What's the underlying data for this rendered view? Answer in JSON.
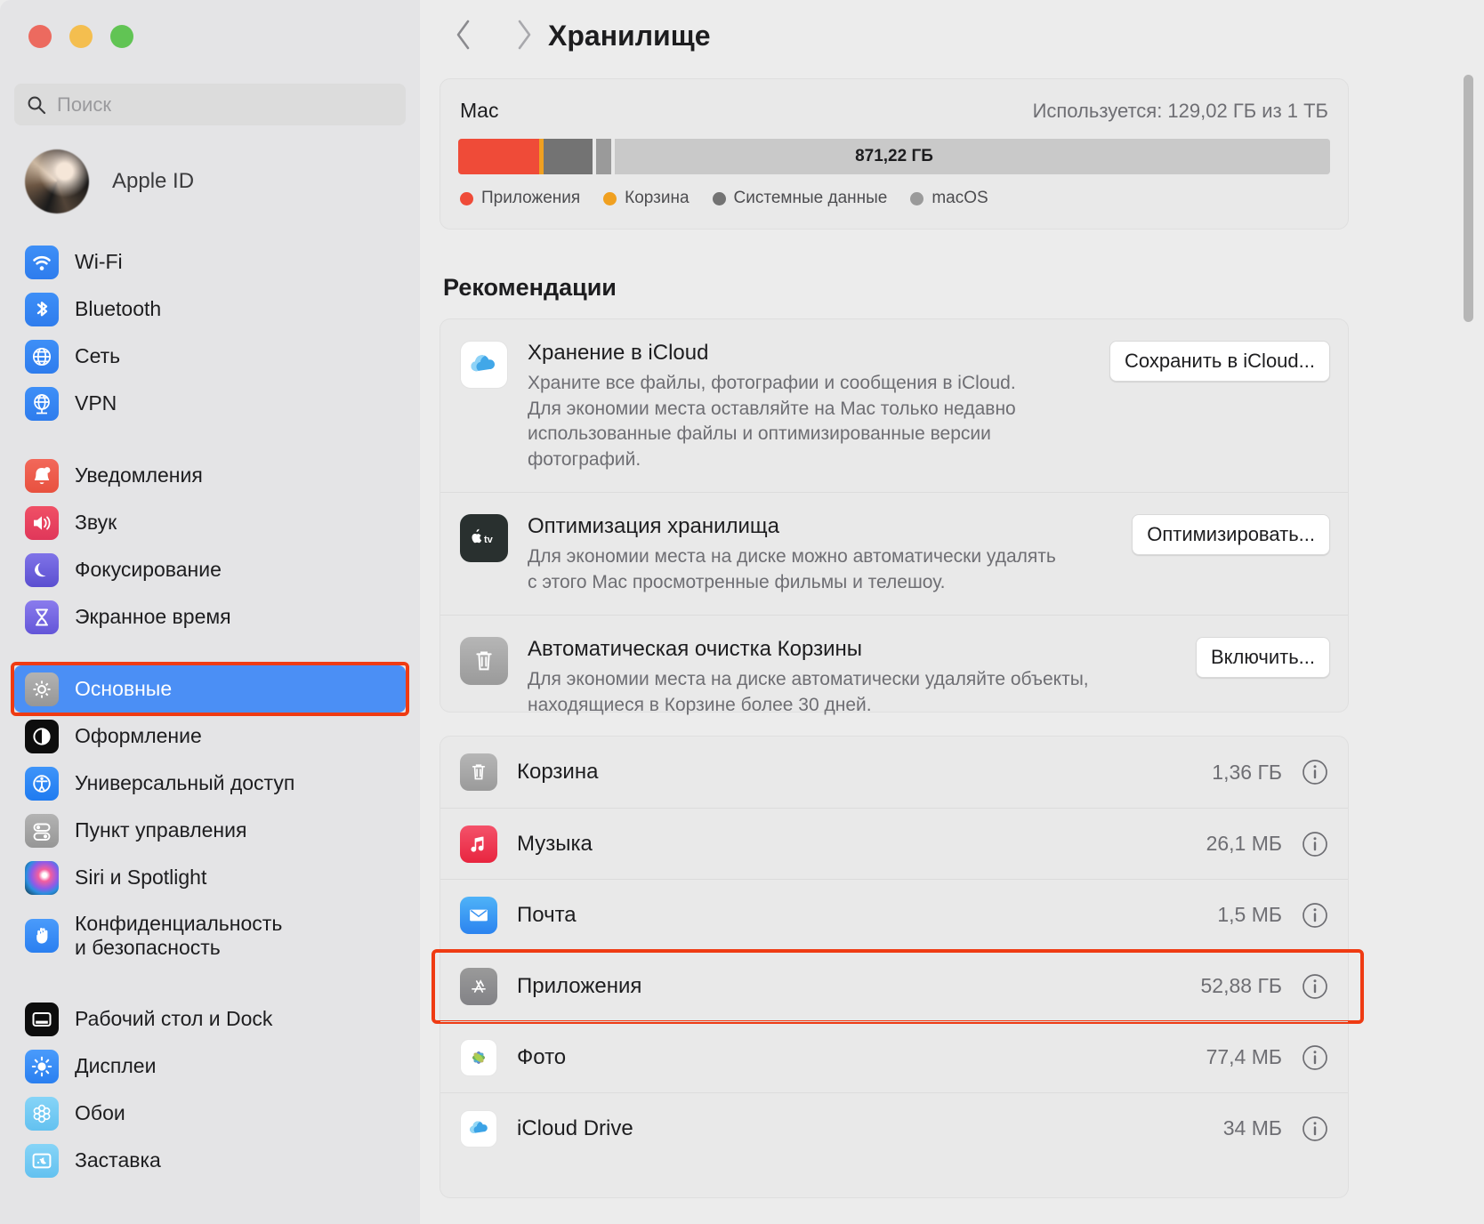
{
  "window": {
    "traffic_lights": [
      "close",
      "minimize",
      "zoom"
    ],
    "colors": {
      "close": "#ec6a5f",
      "minimize": "#f4be4f",
      "zoom": "#61c454",
      "accent": "#4b8ff5",
      "highlight": "#ef3b13"
    }
  },
  "sidebar": {
    "search": {
      "placeholder": "Поиск",
      "icon": "search-icon",
      "value": ""
    },
    "account": {
      "label": "Apple ID",
      "avatar": "user-avatar"
    },
    "groups": [
      {
        "items": [
          {
            "label": "Wi-Fi",
            "icon": "wifi-icon"
          },
          {
            "label": "Bluetooth",
            "icon": "bluetooth-icon"
          },
          {
            "label": "Сеть",
            "icon": "network-globe-icon"
          },
          {
            "label": "VPN",
            "icon": "vpn-globe-icon"
          }
        ]
      },
      {
        "items": [
          {
            "label": "Уведомления",
            "icon": "bell-icon"
          },
          {
            "label": "Звук",
            "icon": "speaker-icon"
          },
          {
            "label": "Фокусирование",
            "icon": "moon-icon"
          },
          {
            "label": "Экранное время",
            "icon": "hourglass-icon"
          }
        ]
      },
      {
        "items": [
          {
            "label": "Основные",
            "icon": "gear-icon",
            "selected": true,
            "highlighted": true
          },
          {
            "label": "Оформление",
            "icon": "appearance-icon"
          },
          {
            "label": "Универсальный доступ",
            "icon": "accessibility-icon"
          },
          {
            "label": "Пункт управления",
            "icon": "control-center-icon"
          },
          {
            "label": "Siri и Spotlight",
            "icon": "siri-icon"
          },
          {
            "label": "Конфиденциальность\nи безопасность",
            "icon": "hand-privacy-icon",
            "two_line": true
          }
        ]
      },
      {
        "items": [
          {
            "label": "Рабочий стол и Dock",
            "icon": "desktop-dock-icon"
          },
          {
            "label": "Дисплеи",
            "icon": "brightness-icon"
          },
          {
            "label": "Обои",
            "icon": "wallpaper-icon"
          },
          {
            "label": "Заставка",
            "icon": "screensaver-icon"
          }
        ]
      }
    ]
  },
  "main": {
    "back_label": "Назад",
    "forward_label": "Вперед",
    "title": "Хранилище",
    "storage": {
      "device_name": "Mac",
      "used_text": "Используется: 129,02 ГБ из 1 ТБ",
      "free_label": "871,22 ГБ",
      "legend": [
        {
          "label": "Приложения",
          "color": "#ef4b38"
        },
        {
          "label": "Корзина",
          "color": "#f0a020"
        },
        {
          "label": "Системные данные",
          "color": "#737373"
        },
        {
          "label": "macOS",
          "color": "#9a9a9a"
        }
      ],
      "segments": [
        {
          "name": "Приложения",
          "color": "#ef4b38",
          "percent": 9.3
        },
        {
          "name": "Корзина",
          "color": "#f0a020",
          "percent": 0.45
        },
        {
          "name": "Системные данные",
          "color": "#737373",
          "percent": 5.7
        },
        {
          "name": "gap",
          "color": "#e9e9e9",
          "percent": 0.4
        },
        {
          "name": "macOS",
          "color": "#9a9a9a",
          "percent": 1.7
        },
        {
          "name": "gap2",
          "color": "#e9e9e9",
          "percent": 0.4
        },
        {
          "name": "Свободно",
          "color": "#c9c9c9",
          "percent": 82.05
        }
      ]
    },
    "recommendations_title": "Рекомендации",
    "recommendations": [
      {
        "icon": "icloud-icon",
        "title": "Хранение в iCloud",
        "description": "Храните все файлы, фотографии и сообщения в iCloud.\nДля экономии места оставляйте на Mac только недавно\nиспользованные файлы и оптимизированные версии\nфотографий.",
        "button": "Сохранить в iCloud..."
      },
      {
        "icon": "apple-tv-icon",
        "title": "Оптимизация хранилища",
        "description": "Для экономии места на диске можно автоматически удалять\nс этого Mac просмотренные фильмы и телешоу.",
        "button": "Оптимизировать..."
      },
      {
        "icon": "trash-icon",
        "title": "Автоматическая очистка Корзины",
        "description": "Для экономии места на диске автоматически удаляйте объекты,\nнаходящиеся в Корзине более 30 дней.",
        "button": "Включить..."
      }
    ],
    "items": [
      {
        "icon": "trash-icon",
        "name": "Корзина",
        "size": "1,36 ГБ",
        "info": "info-icon"
      },
      {
        "icon": "music-icon",
        "name": "Музыка",
        "size": "26,1 МБ",
        "info": "info-icon"
      },
      {
        "icon": "mail-icon",
        "name": "Почта",
        "size": "1,5 МБ",
        "info": "info-icon"
      },
      {
        "icon": "app-store-icon",
        "name": "Приложения",
        "size": "52,88 ГБ",
        "info": "info-icon",
        "highlighted": true
      },
      {
        "icon": "photos-icon",
        "name": "Фото",
        "size": "77,4 МБ",
        "info": "info-icon"
      },
      {
        "icon": "icloud-drive-icon",
        "name": "iCloud Drive",
        "size": "34 МБ",
        "info": "info-icon"
      }
    ]
  }
}
